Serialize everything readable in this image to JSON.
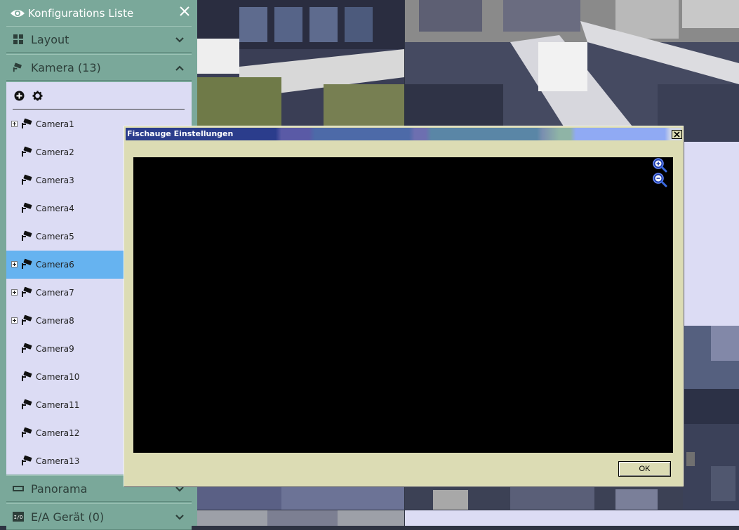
{
  "panel": {
    "title": "Konfigurations Liste",
    "sections": {
      "layout": "Layout",
      "camera": "Kamera (13)",
      "panorama": "Panorama",
      "io": "E/A Gerät (0)"
    },
    "io_icon_text": "I/O",
    "cameras": [
      {
        "label": "Camera1",
        "expandable": true,
        "selected": false
      },
      {
        "label": "Camera2",
        "expandable": false,
        "selected": false
      },
      {
        "label": "Camera3",
        "expandable": false,
        "selected": false
      },
      {
        "label": "Camera4",
        "expandable": false,
        "selected": false
      },
      {
        "label": "Camera5",
        "expandable": false,
        "selected": false
      },
      {
        "label": "Camera6",
        "expandable": true,
        "selected": true
      },
      {
        "label": "Camera7",
        "expandable": true,
        "selected": false
      },
      {
        "label": "Camera8",
        "expandable": true,
        "selected": false
      },
      {
        "label": "Camera9",
        "expandable": false,
        "selected": false
      },
      {
        "label": "Camera10",
        "expandable": false,
        "selected": false
      },
      {
        "label": "Camera11",
        "expandable": false,
        "selected": false
      },
      {
        "label": "Camera12",
        "expandable": false,
        "selected": false
      },
      {
        "label": "Camera13",
        "expandable": false,
        "selected": false
      }
    ],
    "icons": [
      "eye-icon",
      "close-icon",
      "grid-icon",
      "camera-icon",
      "plus-circle-icon",
      "gear-icon",
      "panorama-icon",
      "io-icon",
      "chevron-down-icon",
      "chevron-up-icon",
      "expand-plus-icon"
    ]
  },
  "dialog": {
    "title": "Fischauge Einstellungen",
    "ok_label": "OK",
    "close_glyph": "✕",
    "icons": [
      "zoom-in-icon",
      "zoom-out-icon"
    ]
  },
  "colors": {
    "panel_bg": "#7aa89a",
    "tree_bg": "#dcdcf4",
    "selection": "#66b3f0",
    "dialog_bg": "#dcdcb4",
    "viewport_bg": "#000000"
  }
}
